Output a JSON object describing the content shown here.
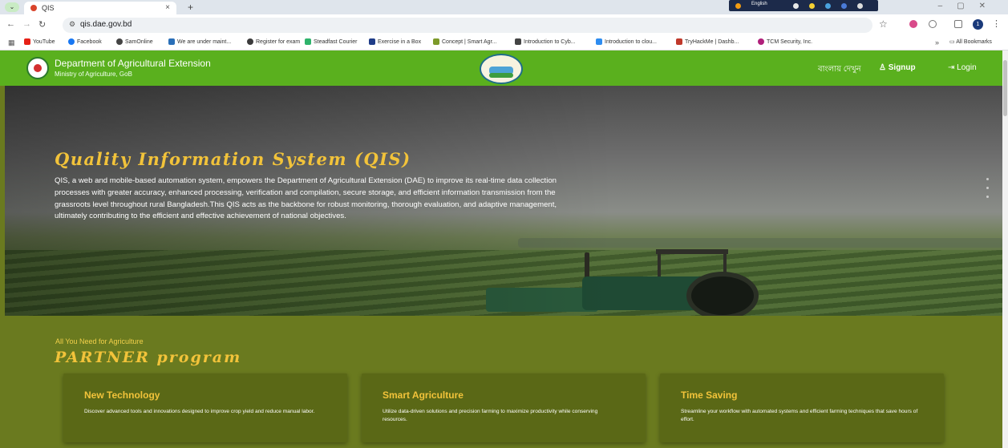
{
  "browser": {
    "tab_title": "QIS",
    "tab_close": "×",
    "new_tab": "+",
    "url": "qis.dae.gov.bd",
    "taskbar_lang": "English",
    "bookmarks": [
      "YouTube",
      "Facebook",
      "SamOnline",
      "We are under maint...",
      "Register for exam",
      "Steadfast Courier",
      "Exercise in a Box",
      "Concept | Smart Agr...",
      "Introduction to Cyb...",
      "Introduction to clou...",
      "TryHackMe | Dashb...",
      "TCM Security, Inc."
    ],
    "bookmarks_more": "»",
    "all_bookmarks": "All Bookmarks",
    "profile_initial": "1"
  },
  "header": {
    "dept_name": "Department of Agricultural Extension",
    "ministry": "Ministry of Agriculture, GoB",
    "lang_link": "বাংলায় দেখুন",
    "signup": "Signup",
    "login": "Login"
  },
  "hero": {
    "title": "Quality Information System (QIS)",
    "description": "QIS, a web and mobile-based automation system, empowers the Department of Agricultural Extension (DAE) to improve its real-time data collection processes with greater accuracy, enhanced processing, verification and compilation, secure storage, and efficient information transmission from the grassroots level throughout rural Bangladesh.This QIS acts as the backbone for robust monitoring, thorough evaluation, and adaptive management, ultimately contributing to the efficient and effective achievement of national objectives."
  },
  "partner": {
    "kicker": "All You Need for Agriculture",
    "title": "PARTNER program",
    "cards": [
      {
        "title": "New Technology",
        "desc": "Discover advanced tools and innovations designed to improve crop yield and reduce manual labor."
      },
      {
        "title": "Smart Agriculture",
        "desc": "Utilize data-driven solutions and precision farming to maximize productivity while conserving resources."
      },
      {
        "title": "Time Saving",
        "desc": "Streamline your workflow with automated systems and efficient farming techniques that save hours of effort."
      }
    ]
  },
  "colors": {
    "header_green": "#5ab01e",
    "olive": "#6a7a1f",
    "accent_gold": "#f2c33a"
  }
}
